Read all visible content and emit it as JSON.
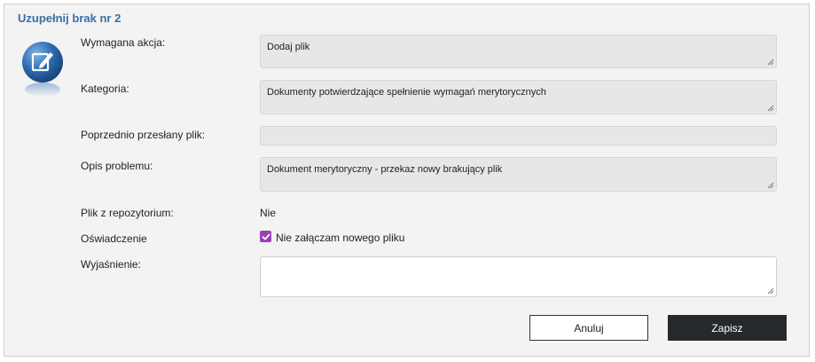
{
  "dialog": {
    "title": "Uzupełnij brak nr 2"
  },
  "form": {
    "required_action": {
      "label": "Wymagana akcja:",
      "value": "Dodaj plik"
    },
    "category": {
      "label": "Kategoria:",
      "value": "Dokumenty potwierdzające spełnienie wymagań merytorycznych"
    },
    "previous_file": {
      "label": "Poprzednio przesłany plik:",
      "value": ""
    },
    "problem_description": {
      "label": "Opis problemu:",
      "value": "Dokument merytoryczny - przekaz nowy brakujący plik"
    },
    "repository_file": {
      "label": "Plik z repozytorium:",
      "value": "Nie"
    },
    "statement": {
      "label": "Oświadczenie",
      "checkbox_label": "Nie załączam nowego pliku",
      "checked": true
    },
    "explanation": {
      "label": "Wyjaśnienie:",
      "value": ""
    }
  },
  "buttons": {
    "cancel": "Anuluj",
    "save": "Zapisz"
  },
  "colors": {
    "title": "#3b6ea6",
    "checkbox": "#9b3fb5",
    "save_button": "#25282c"
  },
  "icons": {
    "header_icon": "edit-document-icon",
    "checkmark": "checkmark-icon",
    "resize": "resize-grip-icon"
  }
}
